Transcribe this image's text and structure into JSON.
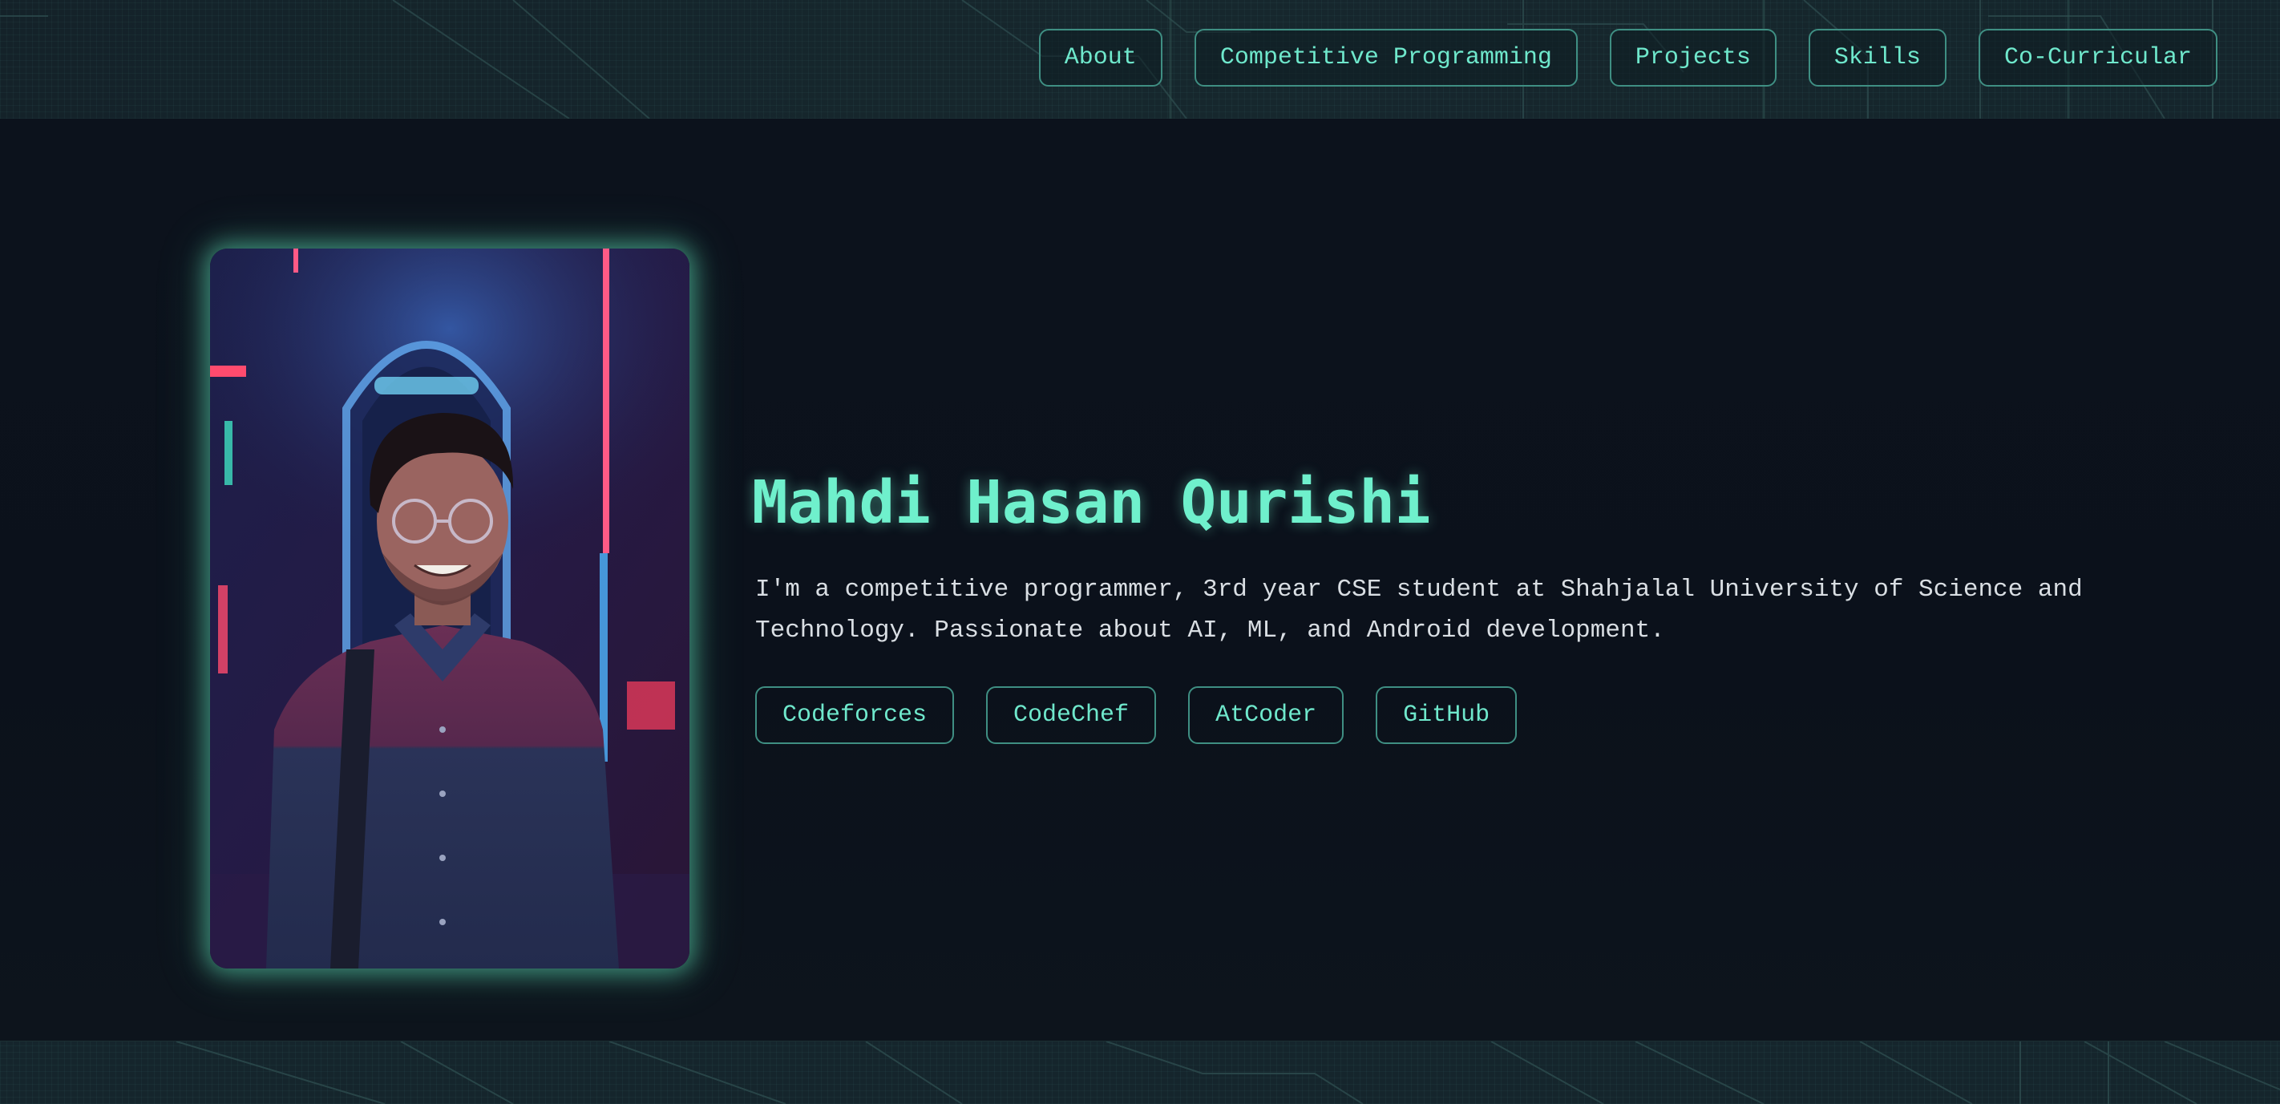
{
  "nav": {
    "items": [
      "About",
      "Competitive Programming",
      "Projects",
      "Skills",
      "Co-Curricular"
    ]
  },
  "hero": {
    "name": "Mahdi Hasan Qurishi",
    "bio": "I'm a competitive programmer, 3rd year CSE student at Shahjalal University of Science and Technology. Passionate about AI, ML, and Android development.",
    "links": [
      "Codeforces",
      "CodeChef",
      "AtCoder",
      "GitHub"
    ],
    "photo": "profile-photo"
  },
  "colors": {
    "accent": "#6ff0cc",
    "border": "#3f8f83",
    "background": "#0b111b",
    "strip": "#15252c",
    "text": "#d9dee3"
  }
}
